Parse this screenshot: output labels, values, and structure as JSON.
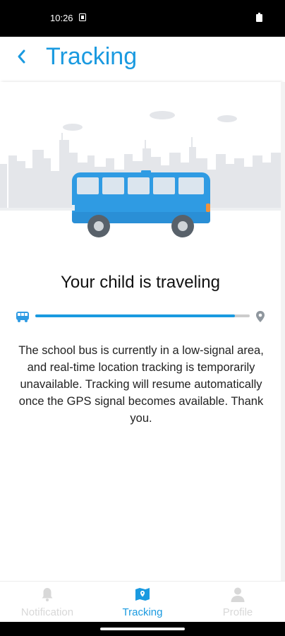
{
  "status_bar": {
    "time": "10:26"
  },
  "header": {
    "title": "Tracking",
    "back_icon": "chevron-left-icon"
  },
  "main": {
    "heading": "Your child is traveling",
    "progress": 0.93,
    "message": "The school bus is currently in a low-signal area, and real-time location tracking is temporarily unavailable. Tracking will resume automatically once the GPS signal becomes available. Thank you."
  },
  "bottom_nav": {
    "items": [
      {
        "label": "Notification",
        "icon": "bell-icon",
        "active": false
      },
      {
        "label": "Tracking",
        "icon": "map-icon",
        "active": true
      },
      {
        "label": "Profile",
        "icon": "person-icon",
        "active": false
      }
    ]
  },
  "colors": {
    "accent": "#1a9ae0",
    "bus_body": "#2f9be3",
    "inactive": "#d8d8d8",
    "skyline": "#e4e6ea"
  }
}
